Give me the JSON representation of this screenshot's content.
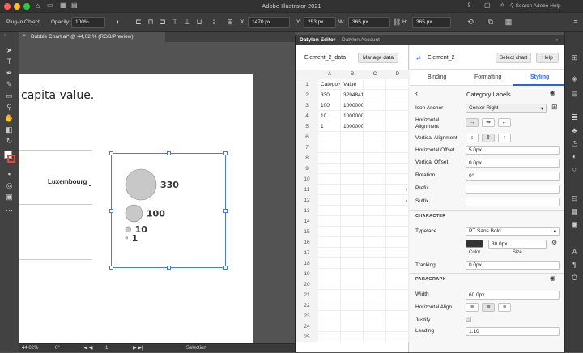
{
  "window": {
    "title": "Adobe Illustrator 2021"
  },
  "control_bar": {
    "selection_label": "Plug-in Object",
    "opacity_label": "Opacity:",
    "opacity_value": "100%",
    "x_label": "X:",
    "x_value": "1470 px",
    "y_label": "Y:",
    "y_value": "253 px",
    "w_label": "W:",
    "w_value": "365 px",
    "h_label": "H:",
    "h_value": "365 px",
    "search_placeholder": "Search Adobe Help"
  },
  "document_tab": {
    "close": "×",
    "label": "Bubble Chart.ai* @ 44,02 % (RGB/Preview)"
  },
  "artboard": {
    "heading": "capita value.",
    "row_label": "Luxembourg"
  },
  "bubble_chart": {
    "labels": [
      "330",
      "100",
      "10",
      "1"
    ],
    "values": [
      330,
      100,
      10,
      1
    ]
  },
  "status_bar": {
    "zoom": "44,02%",
    "rotation": "0°",
    "page": "1",
    "tool": "Selection"
  },
  "plugin": {
    "tabs": [
      "Datylon Editor",
      "Datylon Account"
    ],
    "data": {
      "title": "Element_2_data",
      "manage_button": "Manage data",
      "columns": [
        "A",
        "B",
        "C",
        "D"
      ],
      "row_numbers": [
        "1",
        "2",
        "3",
        "4",
        "5",
        "6",
        "7",
        "8",
        "9",
        "10",
        "11",
        "12",
        "13",
        "14",
        "15",
        "16",
        "17",
        "18",
        "19",
        "20",
        "21",
        "22",
        "23",
        "24",
        "25"
      ],
      "cells": [
        [
          "Category",
          "Value"
        ],
        [
          "330",
          "3294841"
        ],
        [
          "100",
          "1000000"
        ],
        [
          "10",
          "1000000"
        ],
        [
          "1",
          "1000000"
        ]
      ]
    },
    "element": {
      "name": "Element_2",
      "select_chart": "Select chart",
      "help": "Help",
      "tabs": [
        "Binding",
        "Formatting",
        "Styling"
      ],
      "active_tab": "Styling"
    },
    "styling": {
      "section_title": "Category Labels",
      "icon_anchor_label": "Icon Anchor",
      "icon_anchor_value": "Center Right",
      "horizontal_alignment_label": "Horizontal Alignment",
      "vertical_alignment_label": "Vertical Alignment",
      "horizontal_offset_label": "Horizontal Offset",
      "horizontal_offset_value": "5.0px",
      "vertical_offset_label": "Vertical Offset",
      "vertical_offset_value": "0.0px",
      "rotation_label": "Rotation",
      "rotation_value": "0°",
      "prefix_label": "Prefix",
      "prefix_value": "",
      "suffix_label": "Suffix",
      "suffix_value": "",
      "character_header": "CHARACTER",
      "typeface_label": "Typeface",
      "typeface_value": "PT Sans Bold",
      "color_value": "#333333",
      "size_value": "30.0px",
      "color_caption": "Color",
      "size_caption": "Size",
      "tracking_label": "Tracking",
      "tracking_value": "0.0px",
      "paragraph_header": "PARAGRAPH",
      "width_label": "Width",
      "width_value": "60.0px",
      "horizontal_align_label": "Horizontal Align",
      "justify_label": "Justify",
      "leading_label": "Leading",
      "leading_value": "1.10"
    }
  }
}
